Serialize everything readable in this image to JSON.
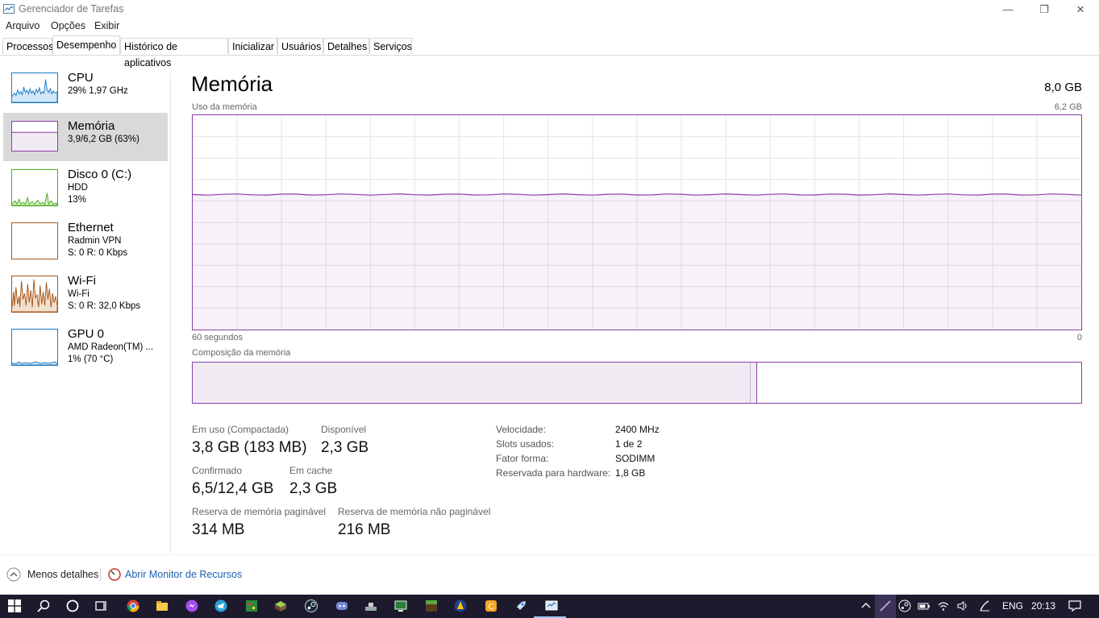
{
  "window": {
    "title": "Gerenciador de Tarefas",
    "controls": [
      "—",
      "❐",
      "✕"
    ]
  },
  "menu": [
    "Arquivo",
    "Opções",
    "Exibir"
  ],
  "tabs": [
    "Processos",
    "Desempenho",
    "Histórico de aplicativos",
    "Inicializar",
    "Usuários",
    "Detalhes",
    "Serviços"
  ],
  "sidebar": {
    "items": [
      {
        "title": "CPU",
        "line1": "29%  1,97 GHz",
        "line2": "",
        "color": "#1b7bc4"
      },
      {
        "title": "Memória",
        "line1": "3,9/6,2 GB (63%)",
        "line2": "",
        "color": "#8b3fa6"
      },
      {
        "title": "Disco 0 (C:)",
        "line1": "HDD",
        "line2": "13%",
        "color": "#4caa1c"
      },
      {
        "title": "Ethernet",
        "line1": "Radmin VPN",
        "line2": "S: 0  R: 0 Kbps",
        "color": "#a7561a"
      },
      {
        "title": "Wi-Fi",
        "line1": "Wi-Fi",
        "line2": "S: 0  R: 32,0 Kbps",
        "color": "#a7561a"
      },
      {
        "title": "GPU 0",
        "line1": "AMD Radeon(TM) ...",
        "line2": "1%  (70 °C)",
        "color": "#1b7bc4"
      }
    ]
  },
  "main": {
    "title": "Memória",
    "total": "8,0 GB",
    "usage_label": "Uso da memória",
    "usage_max": "6,2 GB",
    "time_left": "60 segundos",
    "time_right": "0",
    "composition_label": "Composição da memória",
    "usage_fraction": 0.63,
    "composition": {
      "in_use_fraction": 0.627,
      "modified_fraction": 0.006
    }
  },
  "stats": {
    "in_use_label": "Em uso (Compactada)",
    "in_use_value": "3,8 GB (183 MB)",
    "available_label": "Disponível",
    "available_value": "2,3 GB",
    "committed_label": "Confirmado",
    "committed_value": "6,5/12,4 GB",
    "cached_label": "Em cache",
    "cached_value": "2,3 GB",
    "paged_label": "Reserva de memória paginável",
    "paged_value": "314 MB",
    "nonpaged_label": "Reserva de memória não paginável",
    "nonpaged_value": "216 MB"
  },
  "details": [
    {
      "label": "Velocidade:",
      "value": "2400 MHz"
    },
    {
      "label": "Slots usados:",
      "value": "1 de 2"
    },
    {
      "label": "Fator forma:",
      "value": "SODIMM"
    },
    {
      "label": "Reservada para hardware:",
      "value": "1,8 GB"
    }
  ],
  "footer": {
    "less_details": "Menos detalhes",
    "resource_monitor": "Abrir Monitor de Recursos"
  },
  "taskbar": {
    "language": "ENG",
    "time": "20:13"
  }
}
